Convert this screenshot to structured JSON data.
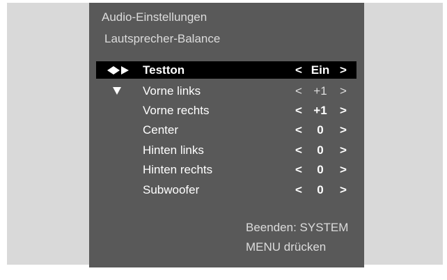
{
  "menu": {
    "title": "Audio-Einstellungen",
    "subtitle": "Lautsprecher-Balance"
  },
  "icons": {
    "cursor": "diamond-play-cursor-icon",
    "down": "down-triangle-icon"
  },
  "rows": [
    {
      "label": "Testton",
      "left_arrow": "<",
      "value": "Ein",
      "right_arrow": ">"
    },
    {
      "label": "Vorne links",
      "left_arrow": "<",
      "value": "+1",
      "right_arrow": ">"
    },
    {
      "label": "Vorne rechts",
      "left_arrow": "<",
      "value": "+1",
      "right_arrow": ">"
    },
    {
      "label": "Center",
      "left_arrow": "<",
      "value": "0",
      "right_arrow": ">"
    },
    {
      "label": "Hinten links",
      "left_arrow": "<",
      "value": "0",
      "right_arrow": ">"
    },
    {
      "label": "Hinten rechts",
      "left_arrow": "<",
      "value": "0",
      "right_arrow": ">"
    },
    {
      "label": "Subwoofer",
      "left_arrow": "<",
      "value": "0",
      "right_arrow": ">"
    }
  ],
  "footer": {
    "line1": "Beenden: SYSTEM",
    "line2": "MENU drücken"
  },
  "colors": {
    "panel_background": "#595959",
    "outer_background": "#d9d9d9",
    "highlight_background": "#000000",
    "text": "#ffffff"
  }
}
